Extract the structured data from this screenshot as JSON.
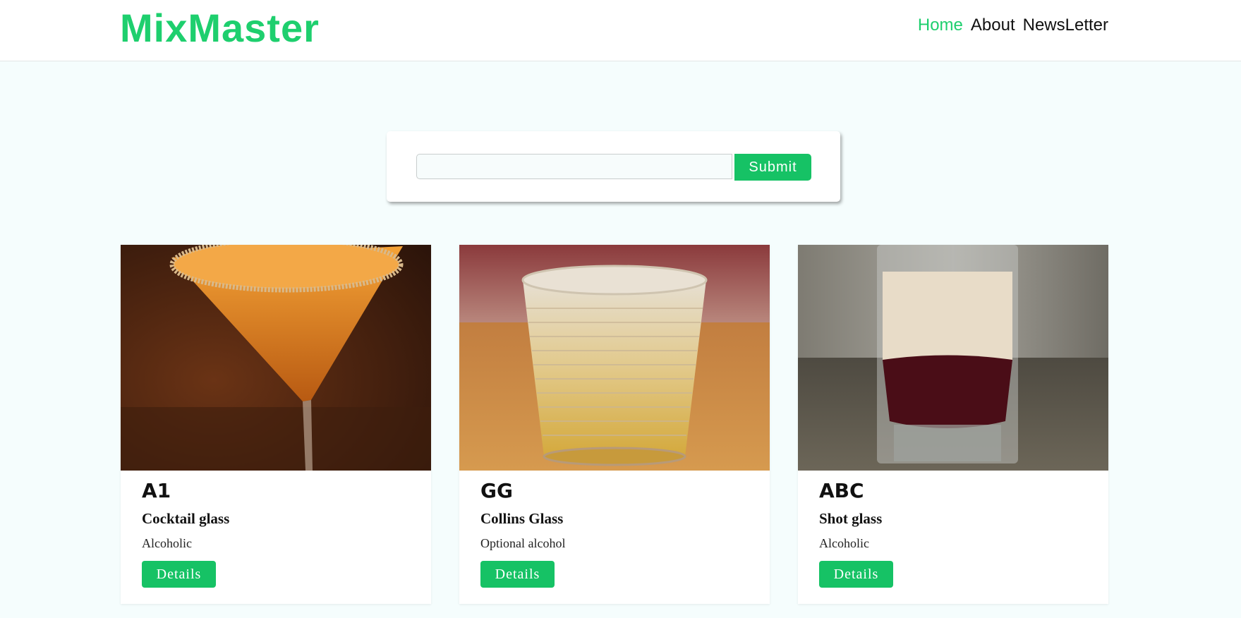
{
  "header": {
    "logo": "MixMaster",
    "nav": [
      {
        "label": "Home",
        "active": true
      },
      {
        "label": "About",
        "active": false
      },
      {
        "label": "NewsLetter",
        "active": false
      }
    ]
  },
  "search": {
    "value": "",
    "placeholder": "",
    "submit_label": "Submit"
  },
  "cocktails": [
    {
      "name": "A1",
      "glass": "Cocktail glass",
      "alcoholic": "Alcoholic",
      "details_label": "Details",
      "image": "orange-martini-with-sugar-rim"
    },
    {
      "name": "GG",
      "glass": "Collins Glass",
      "alcoholic": "Optional alcohol",
      "details_label": "Details",
      "image": "textured-glass-with-ice"
    },
    {
      "name": "ABC",
      "glass": "Shot glass",
      "alcoholic": "Alcoholic",
      "details_label": "Details",
      "image": "layered-cream-and-red-shot"
    }
  ],
  "colors": {
    "accent": "#1ecf6e",
    "button": "#16c265",
    "page_bg": "#f5fdfd"
  }
}
